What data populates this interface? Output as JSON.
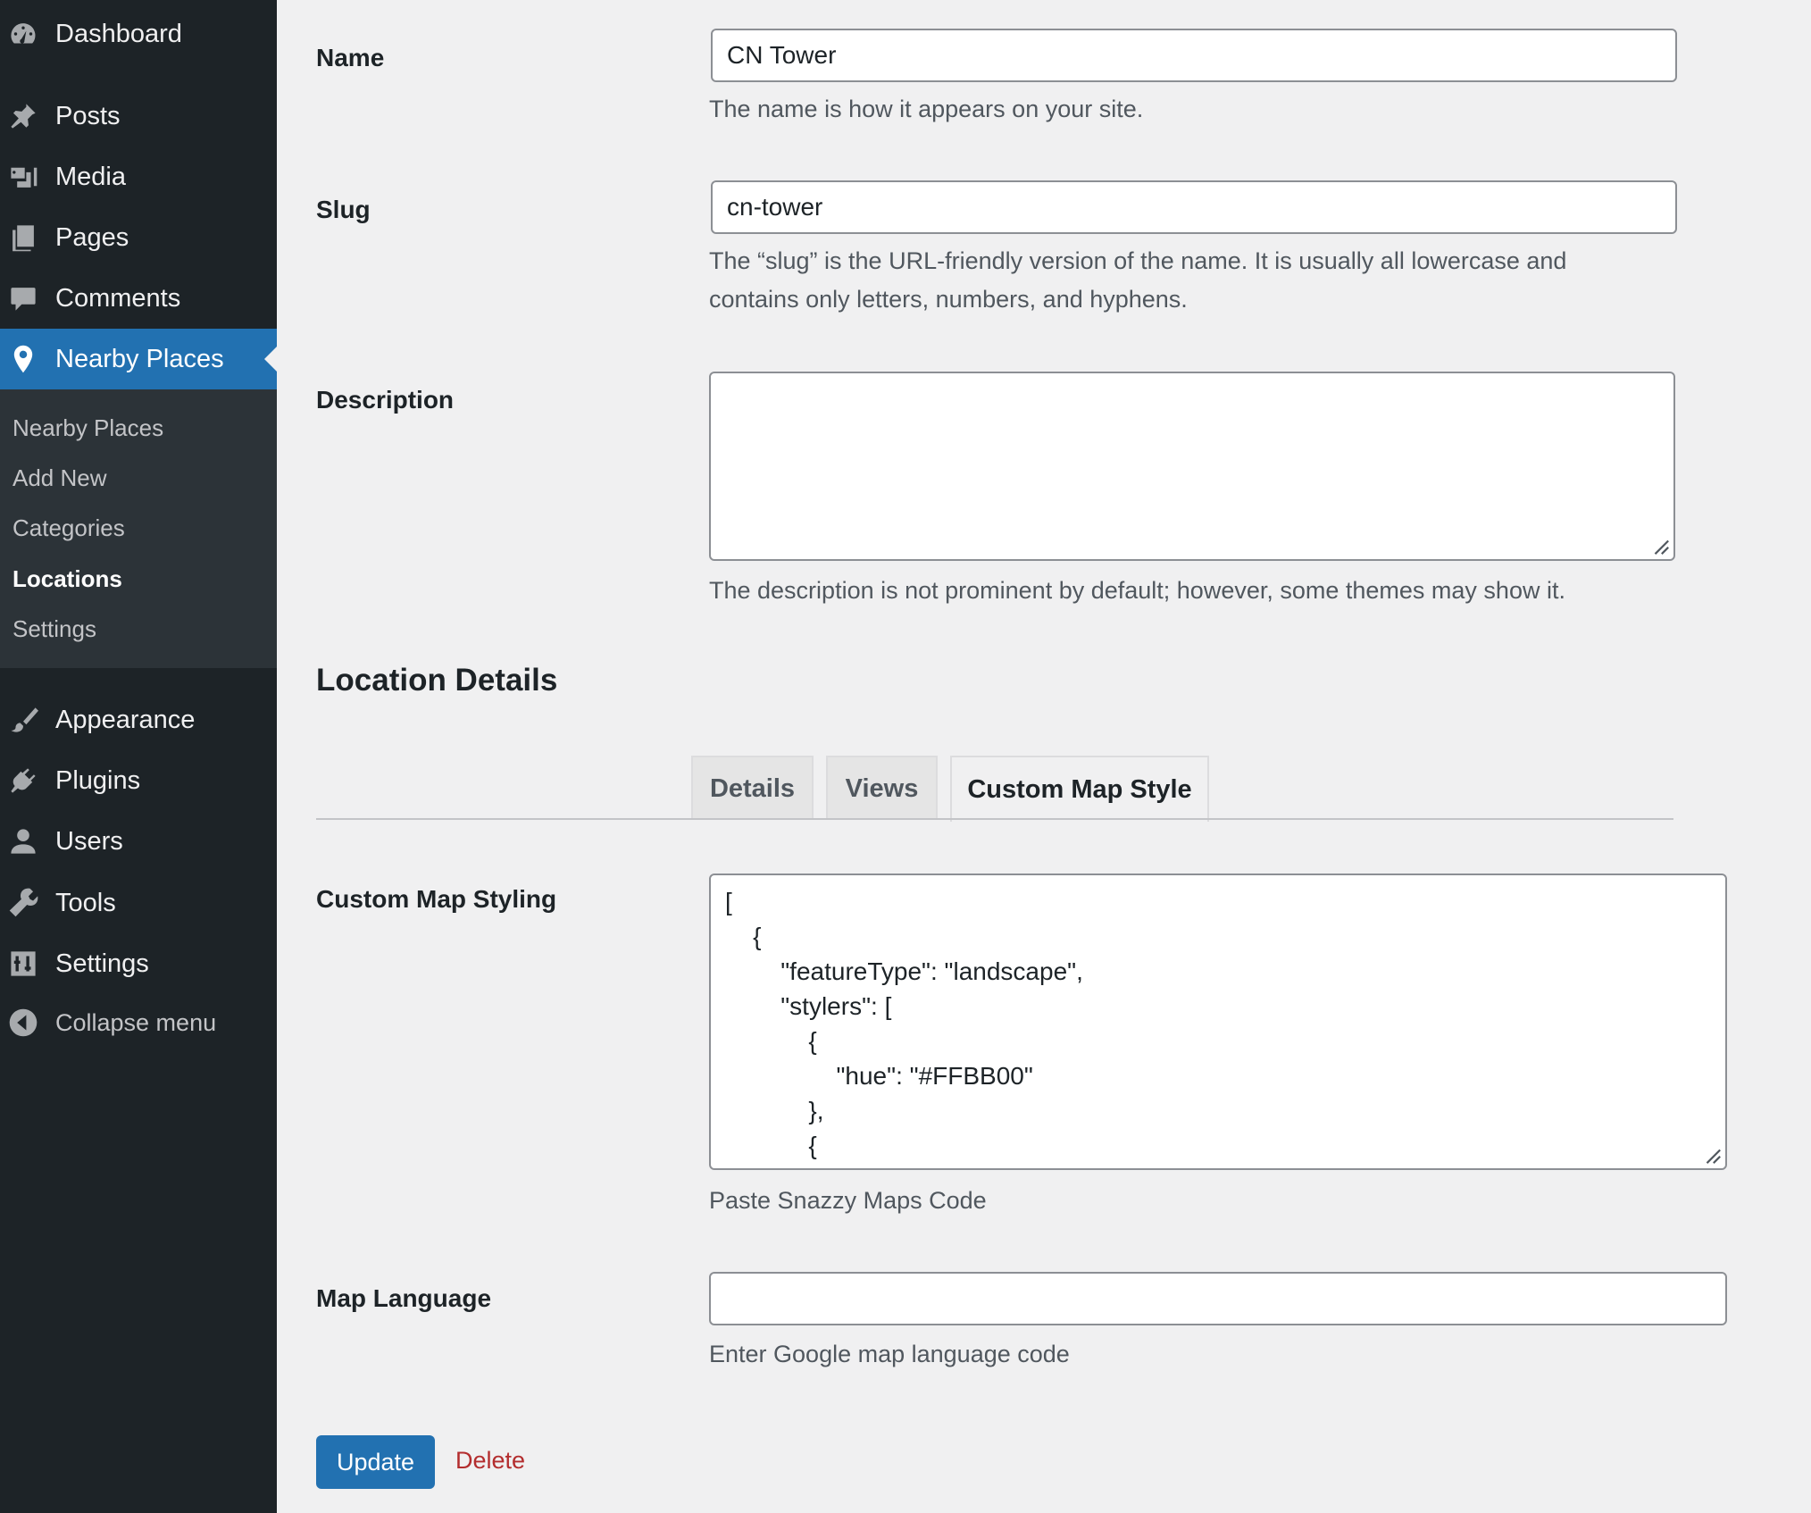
{
  "sidebar": {
    "menu": [
      {
        "label": "Dashboard",
        "icon": "dashboard-icon"
      },
      {
        "label": "Posts",
        "icon": "pin-icon"
      },
      {
        "label": "Media",
        "icon": "media-icon"
      },
      {
        "label": "Pages",
        "icon": "pages-icon"
      },
      {
        "label": "Comments",
        "icon": "comment-icon"
      },
      {
        "label": "Nearby Places",
        "icon": "location-pin-icon"
      },
      {
        "label": "Appearance",
        "icon": "brush-icon"
      },
      {
        "label": "Plugins",
        "icon": "plug-icon"
      },
      {
        "label": "Users",
        "icon": "user-icon"
      },
      {
        "label": "Tools",
        "icon": "wrench-icon"
      },
      {
        "label": "Settings",
        "icon": "sliders-icon"
      },
      {
        "label": "Collapse menu",
        "icon": "collapse-arrow-icon"
      }
    ],
    "submenu": [
      "Nearby Places",
      "Add New",
      "Categories",
      "Locations",
      "Settings"
    ],
    "active_color": "#2271b1",
    "background": "#1d2327"
  },
  "form": {
    "name": {
      "label": "Name",
      "value": "CN Tower",
      "help": "The name is how it appears on your site."
    },
    "slug": {
      "label": "Slug",
      "value": "cn-tower",
      "help_line1": "The “slug” is the URL-friendly version of the name. It is usually all lowercase and",
      "help_line2": "contains only letters, numbers, and hyphens."
    },
    "description": {
      "label": "Description",
      "value": "",
      "help": "The description is not prominent by default; however, some themes may show it."
    }
  },
  "location_details": {
    "title": "Location Details",
    "tabs": [
      "Details",
      "Views",
      "Custom Map Style"
    ],
    "active_tab": "Custom Map Style",
    "custom_map_styling": {
      "label": "Custom Map Styling",
      "code_lines": [
        "[",
        "    {",
        "        \"featureType\": \"landscape\",",
        "        \"stylers\": [",
        "            {",
        "                \"hue\": \"#FFBB00\"",
        "            },",
        "            {"
      ],
      "help": "Paste Snazzy Maps Code"
    },
    "map_language": {
      "label": "Map Language",
      "value": "",
      "help": "Enter Google map language code"
    }
  },
  "actions": {
    "update": "Update",
    "delete": "Delete"
  }
}
